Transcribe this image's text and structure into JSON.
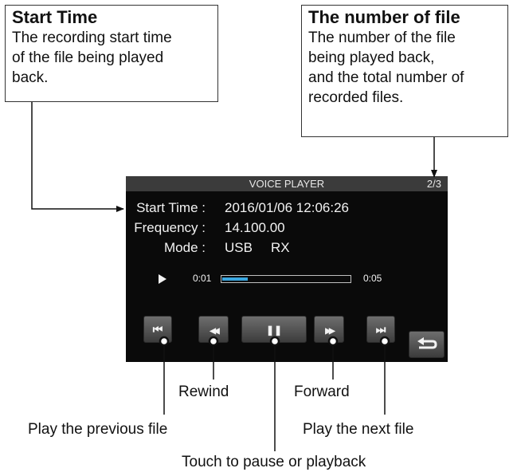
{
  "callouts": {
    "start_time": {
      "title": "Start Time",
      "body": [
        "The recording start time",
        "of the file being played",
        "back."
      ]
    },
    "number_of_file": {
      "title": "The number of file",
      "body": [
        "The number of the file",
        "being played back,",
        "and the total number of",
        "recorded files."
      ]
    }
  },
  "screen": {
    "header_title": "VOICE PLAYER",
    "file_counter": "2/3",
    "start_time_label": "Start Time :",
    "start_time_value": "2016/01/06   12:06:26",
    "frequency_label": "Frequency :",
    "frequency_value": "14.100.00",
    "mode_label": "Mode :",
    "mode_value": "USB",
    "rx_value": "RX",
    "play_icon": "play-icon",
    "elapsed": "0:01",
    "total": "0:05",
    "progress_fraction": 0.2,
    "accent_color": "#3aa7e0",
    "buttons": [
      {
        "name": "previous-file-button",
        "icon": "skip-previous-icon",
        "glyph": "⏮"
      },
      {
        "name": "rewind-button",
        "icon": "rewind-icon",
        "glyph": "◀◀"
      },
      {
        "name": "pause-button",
        "icon": "pause-icon",
        "glyph": "❚❚"
      },
      {
        "name": "forward-button",
        "icon": "fast-forward-icon",
        "glyph": "▶▶"
      },
      {
        "name": "next-file-button",
        "icon": "skip-next-icon",
        "glyph": "⏭"
      }
    ],
    "back_icon": "return-icon"
  },
  "labels": {
    "rewind": "Rewind",
    "forward": "Forward",
    "previous": "Play the previous file",
    "next": "Play the next file",
    "pause": "Touch to pause or playback"
  }
}
